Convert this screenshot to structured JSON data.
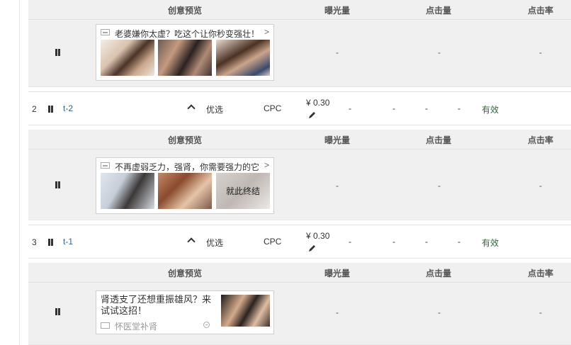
{
  "headers": {
    "preview": "创意预览",
    "impressions": "曝光量",
    "clicks": "点击量",
    "ctr": "点击率"
  },
  "dash": "-",
  "block1": {
    "creative": {
      "title": "老婆嫌你太虚？吃这个让你秒变强壮！",
      "arrow": ">",
      "images": [
        "photo",
        "photo",
        "photo"
      ]
    },
    "impressions": "-",
    "clicks": "-",
    "ctr": "-"
  },
  "row2": {
    "index": "2",
    "name": "t-2",
    "mode": "优选",
    "bid_type": "CPC",
    "price": "¥ 0.30",
    "metrics": [
      "-",
      "-",
      "-",
      "-"
    ],
    "status": "有效"
  },
  "block2": {
    "creative": {
      "title": "不再虚弱乏力，强肾，你需要强力的它",
      "arrow": ">",
      "overlay": "就此终结"
    },
    "impressions": "-",
    "clicks": "-",
    "ctr": "-"
  },
  "row3": {
    "index": "3",
    "name": "t-1",
    "mode": "优选",
    "bid_type": "CPC",
    "price": "¥ 0.30",
    "metrics": [
      "-",
      "-",
      "-",
      "-"
    ],
    "status": "有效"
  },
  "block3": {
    "creative": {
      "title": "肾透支了还想重振雄风？来试试这招！",
      "brand": "怀医堂补肾"
    },
    "impressions": "-",
    "clicks": "-",
    "ctr": "-"
  },
  "colors": {
    "link": "#2a6496",
    "status": "#2d6a3a",
    "subpanel": "#f0f0f0"
  }
}
